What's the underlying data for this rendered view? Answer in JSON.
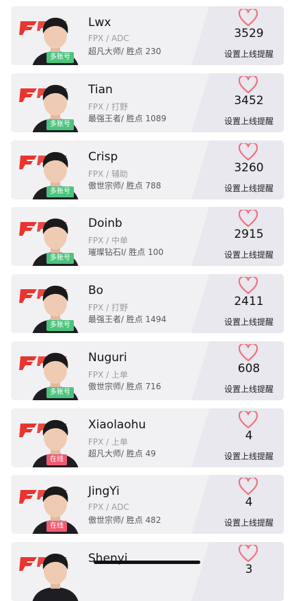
{
  "players": [
    {
      "name": "Lwx",
      "team": "FPX / ADC",
      "rank": "超凡大师/ 胜点 230",
      "badge": "多账号",
      "badge_type": "multi",
      "followers": "3529",
      "remind": "设置上线提醒"
    },
    {
      "name": "Tian",
      "team": "FPX / 打野",
      "rank": "最强王者/ 胜点 1089",
      "badge": "多账号",
      "badge_type": "multi",
      "followers": "3452",
      "remind": "设置上线提醒"
    },
    {
      "name": "Crisp",
      "team": "FPX / 辅助",
      "rank": "傲世宗师/ 胜点 788",
      "badge": "多账号",
      "badge_type": "multi",
      "followers": "3260",
      "remind": "设置上线提醒"
    },
    {
      "name": "Doinb",
      "team": "FPX / 中单",
      "rank": "璀璨钻石I/ 胜点 100",
      "badge": "多账号",
      "badge_type": "multi",
      "followers": "2915",
      "remind": "设置上线提醒"
    },
    {
      "name": "Bo",
      "team": "FPX / 打野",
      "rank": "最强王者/ 胜点 1494",
      "badge": "多账号",
      "badge_type": "multi",
      "followers": "2411",
      "remind": "设置上线提醒"
    },
    {
      "name": "Nuguri",
      "team": "FPX / 上单",
      "rank": "傲世宗师/ 胜点 716",
      "badge": "多账号",
      "badge_type": "multi",
      "followers": "608",
      "remind": "设置上线提醒"
    },
    {
      "name": "Xiaolaohu",
      "team": "FPX / 上单",
      "rank": "超凡大师/ 胜点 49",
      "badge": "在线",
      "badge_type": "online",
      "followers": "4",
      "remind": "设置上线提醒"
    },
    {
      "name": "JingYi",
      "team": "FPX / ADC",
      "rank": "傲世宗师/ 胜点 482",
      "badge": "在线",
      "badge_type": "online",
      "followers": "4",
      "remind": "设置上线提醒"
    },
    {
      "name": "Shenyi",
      "team": "",
      "rank": "",
      "badge": "",
      "badge_type": "",
      "followers": "3",
      "remind": ""
    }
  ],
  "colors": {
    "badge_multi": "#4cc47e",
    "badge_online": "#f05b72",
    "heart": "#f0707e",
    "logo": "#e8352f"
  },
  "icons": {
    "heart": "heart-icon",
    "logo": "fpx-logo"
  }
}
